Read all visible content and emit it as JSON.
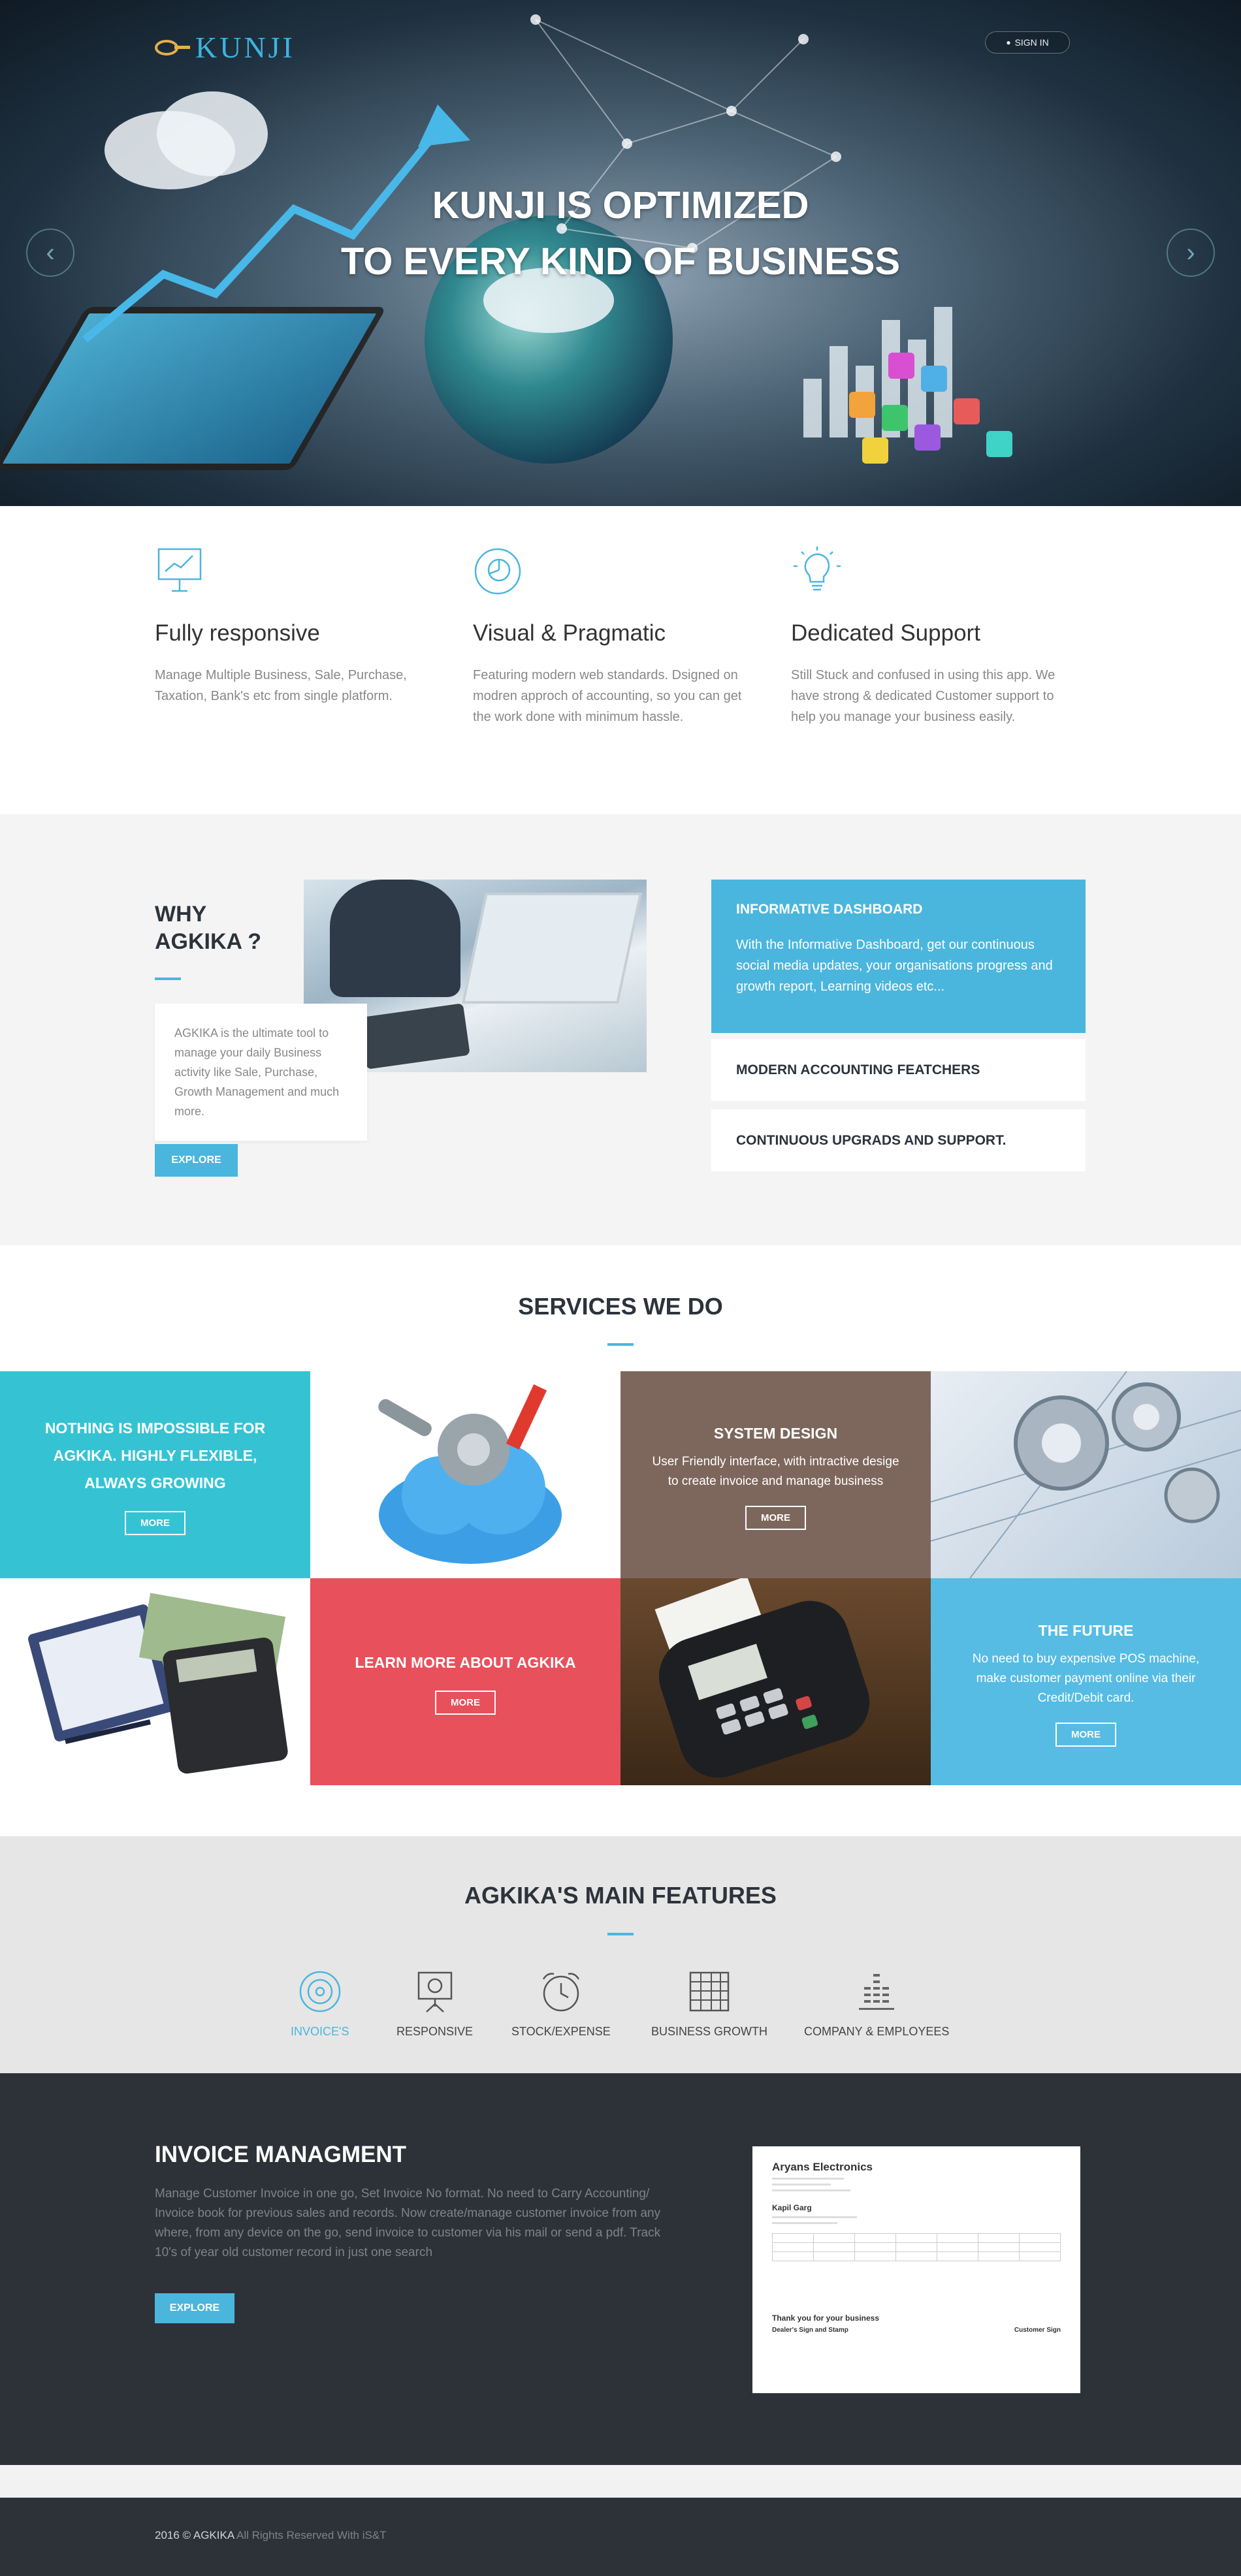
{
  "brand": {
    "name": "KUNJI",
    "accent": "#4ab6dd"
  },
  "header": {
    "signin_label": "SIGN IN"
  },
  "hero": {
    "title_line1": "KUNJI IS OPTIMIZED",
    "title_line2": "TO EVERY KIND OF BUSINESS",
    "prev_icon": "chevron-left-icon",
    "next_icon": "chevron-right-icon"
  },
  "features": [
    {
      "icon": "presentation-chart-icon",
      "title": "Fully responsive",
      "text": "Manage Multiple Business, Sale, Purchase, Taxation, Bank's etc from single platform."
    },
    {
      "icon": "pie-chart-icon",
      "title": "Visual & Pragmatic",
      "text": "Featuring modern web standards. Dsigned on modren approch of accounting, so you can get the work done with minimum hassle."
    },
    {
      "icon": "lightbulb-icon",
      "title": "Dedicated Support",
      "text": "Still Stuck and confused in using this app. We have strong & dedicated Customer support to help you manage your business easily."
    }
  ],
  "why": {
    "title_line1": "WHY",
    "title_line2": "AGKIKA ?",
    "text": "AGKIKA is the ultimate tool to manage your daily Business activity like Sale, Purchase, Growth Management and much more.",
    "button": "EXPLORE",
    "accordion": [
      {
        "title": "INFORMATIVE DASHBOARD",
        "text": "With the Informative Dashboard, get our continuous social media updates, your organisations progress and growth report, Learning videos etc..."
      },
      {
        "title": "MODERN ACCOUNTING FEATCHERS"
      },
      {
        "title": "CONTINUOUS UPGRADS AND SUPPORT."
      }
    ]
  },
  "services": {
    "title": "SERVICES WE DO",
    "tiles": [
      {
        "title": "NOTHING IS IMPOSSIBLE FOR AGKIKA. HIGHLY FLEXIBLE, ALWAYS GROWING",
        "button": "MORE",
        "color": "#35c3d3"
      },
      {
        "title": "SYSTEM DESIGN",
        "text": "User Friendly interface, with intractive desige to create invoice and manage business",
        "button": "MORE",
        "color": "#7d675d"
      },
      {
        "title": "LEARN MORE ABOUT AGKIKA",
        "button": "MORE",
        "color": "#e8505b"
      },
      {
        "title": "THE FUTURE",
        "text": "No need to buy expensive POS machine, make customer payment online via their Credit/Debit card.",
        "button": "MORE",
        "color": "#56bce4"
      }
    ],
    "images": [
      "cloud-tools-image",
      "engineering-gears-image",
      "checkbook-calculator-image",
      "pos-terminal-image"
    ]
  },
  "main_features": {
    "title": "AGKIKA'S MAIN FEATURES",
    "tabs": [
      {
        "label": "INVOICE'S",
        "icon": "disc-icon"
      },
      {
        "label": "RESPONSIVE",
        "icon": "easel-chart-icon"
      },
      {
        "label": "STOCK/EXPENSE",
        "icon": "alarm-clock-icon"
      },
      {
        "label": "BUSINESS GROWTH",
        "icon": "grid-table-icon"
      },
      {
        "label": "COMPANY & EMPLOYEES",
        "icon": "bar-stack-icon"
      }
    ]
  },
  "invoice": {
    "title": "INVOICE MANAGMENT",
    "text": "Manage Customer Invoice in one go, Set Invoice No format. No need to Carry Accounting/ Invoice book for previous sales and records. Now create/manage customer invoice from any where, from any device on the go, send invoice to customer via his mail or send a pdf. Track 10's of year old customer record in just one search",
    "button": "EXPLORE",
    "doc": {
      "company": "Aryans Electronics",
      "bill_to": "Kapil Garg",
      "thanks": "Thank you for your business",
      "sig1": "Dealer's Sign and Stamp",
      "sig2": "Customer Sign"
    }
  },
  "footer": {
    "year": "2016 © AGKIKA",
    "rights": " All Rights Reserved With iS&T"
  }
}
